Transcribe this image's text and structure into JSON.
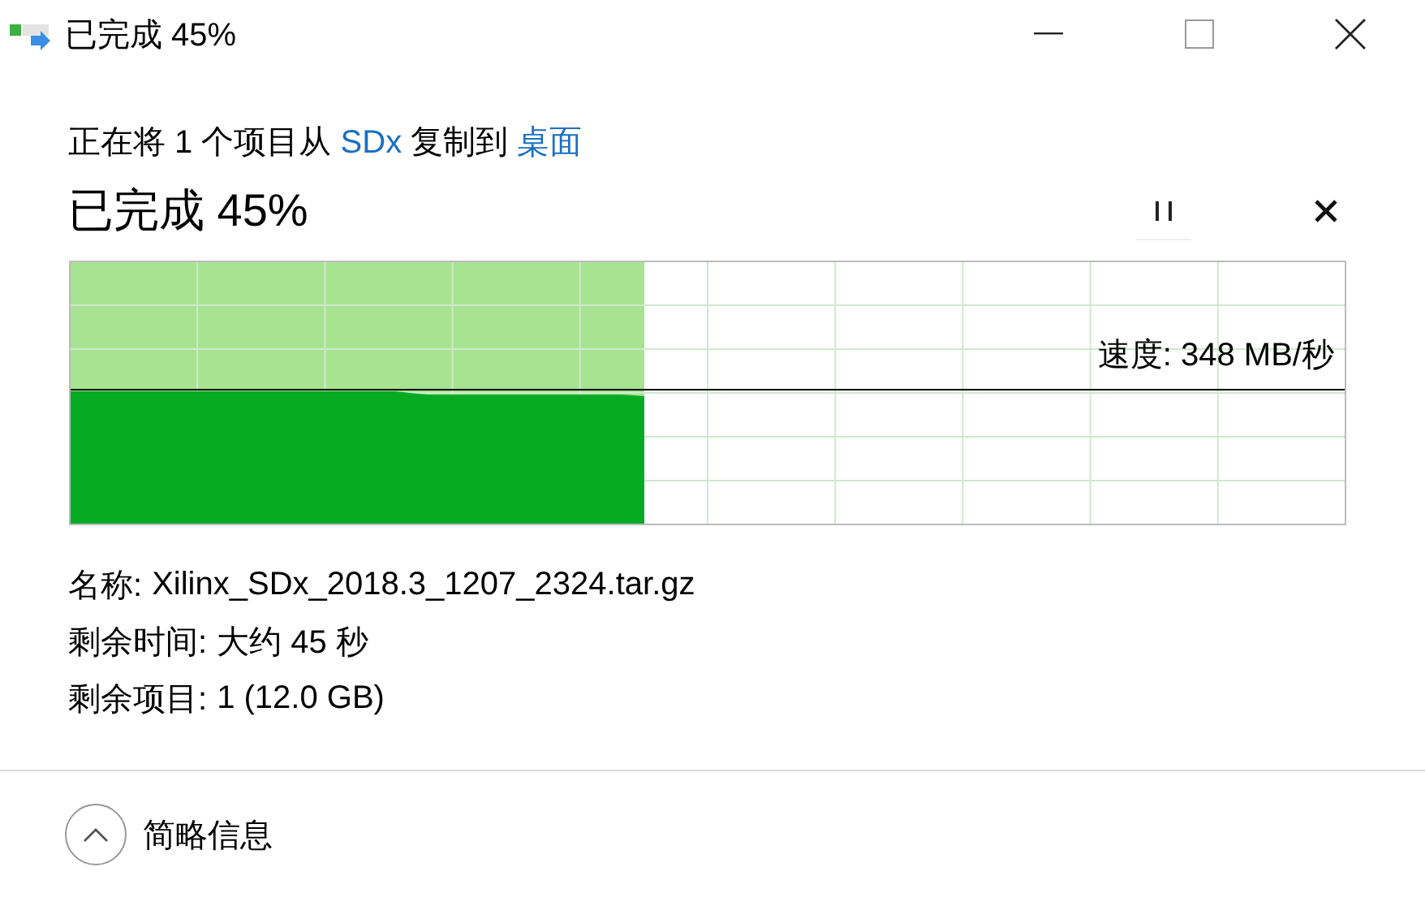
{
  "window": {
    "title": "已完成 45%"
  },
  "summary": {
    "prefix": "正在将 1 个项目从 ",
    "source": "SDx",
    "middle": " 复制到 ",
    "destination": "桌面"
  },
  "progress": {
    "heading": "已完成 45%",
    "level": 0.45,
    "speed": "速度: 348 MB/秒"
  },
  "details": [
    {
      "label": "名称:",
      "value": "Xilinx_SDx_2018.3_1207_2324.tar.gz"
    },
    {
      "label": "剩余时间:",
      "value": "大约 45 秒"
    },
    {
      "label": "剩余项目:",
      "value": "1 (12.0 GB)"
    }
  ],
  "footer": {
    "toggle": "简略信息",
    "expanded": true
  }
}
